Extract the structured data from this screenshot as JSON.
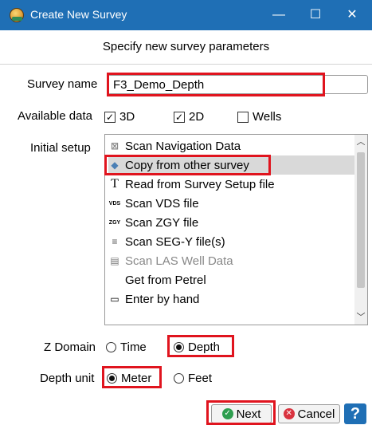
{
  "window": {
    "title": "Create New Survey",
    "minimize_glyph": "—",
    "maximize_glyph": "☐",
    "close_glyph": "✕"
  },
  "header": {
    "text": "Specify new survey parameters"
  },
  "survey_name": {
    "label": "Survey name",
    "value": "F3_Demo_Depth"
  },
  "available_data": {
    "label": "Available data",
    "options": [
      {
        "label": "3D",
        "checked": true
      },
      {
        "label": "2D",
        "checked": true
      },
      {
        "label": "Wells",
        "checked": false
      }
    ]
  },
  "initial_setup": {
    "label": "Initial setup",
    "items": [
      {
        "label": "Scan Navigation Data",
        "icon": "⊠",
        "icon_name": "navigation-icon",
        "selected": false,
        "disabled": false
      },
      {
        "label": "Copy from other survey",
        "icon": "◆",
        "icon_name": "copy-survey-icon",
        "selected": true,
        "disabled": false
      },
      {
        "label": "Read from Survey Setup file",
        "icon": "T",
        "icon_name": "text-file-icon",
        "selected": false,
        "disabled": false
      },
      {
        "label": "Scan VDS file",
        "icon": "VDS",
        "icon_name": "vds-icon",
        "selected": false,
        "disabled": false
      },
      {
        "label": "Scan ZGY file",
        "icon": "ZGY",
        "icon_name": "zgy-icon",
        "selected": false,
        "disabled": false
      },
      {
        "label": "Scan SEG-Y file(s)",
        "icon": "≡",
        "icon_name": "segy-icon",
        "selected": false,
        "disabled": false
      },
      {
        "label": "Scan LAS Well Data",
        "icon": "▤",
        "icon_name": "las-icon",
        "selected": false,
        "disabled": true
      },
      {
        "label": "Get from Petrel",
        "icon": "",
        "icon_name": "petrel-icon",
        "selected": false,
        "disabled": false
      },
      {
        "label": "Enter by hand",
        "icon": "▭",
        "icon_name": "keyboard-icon",
        "selected": false,
        "disabled": false
      }
    ]
  },
  "z_domain": {
    "label": "Z Domain",
    "options": [
      {
        "label": "Time",
        "selected": false
      },
      {
        "label": "Depth",
        "selected": true
      }
    ]
  },
  "depth_unit": {
    "label": "Depth unit",
    "options": [
      {
        "label": "Meter",
        "selected": true
      },
      {
        "label": "Feet",
        "selected": false
      }
    ]
  },
  "buttons": {
    "next": "Next",
    "cancel": "Cancel",
    "help": "?"
  },
  "colors": {
    "titlebar": "#1f6fb5",
    "highlight": "#e0141e",
    "next_icon": "#2e9e4f",
    "cancel_icon": "#d9333f"
  }
}
